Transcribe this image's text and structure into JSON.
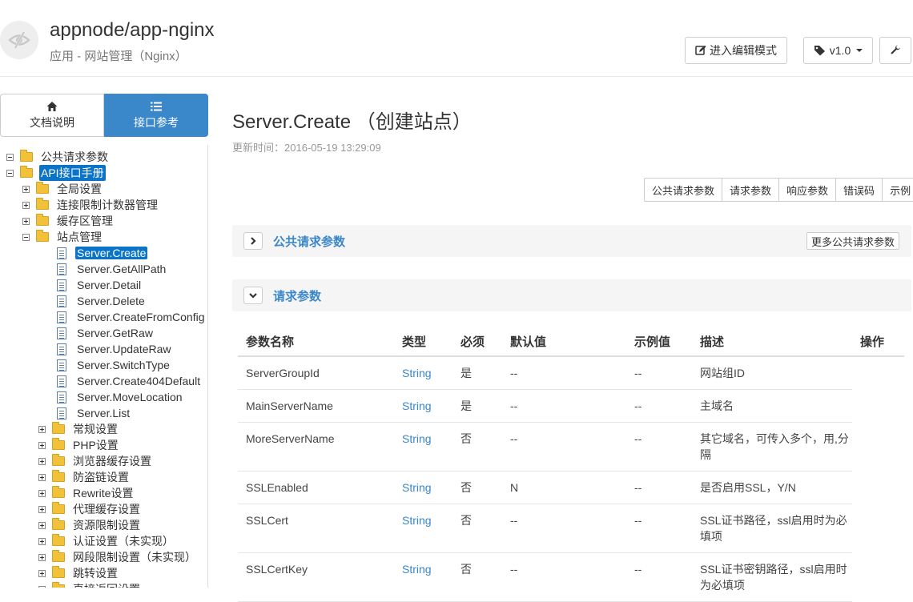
{
  "header": {
    "title": "appnode/app-nginx",
    "subtitle": "应用 - 网站管理（Nginx）",
    "edit_mode_label": "进入编辑模式",
    "version_label": "v1.0"
  },
  "sidebar": {
    "tabs": [
      {
        "label": "文档说明",
        "icon": "home-icon"
      },
      {
        "label": "接口参考",
        "icon": "list-icon"
      }
    ],
    "tree": [
      {
        "label": "公共请求参数",
        "kind": "folder",
        "toggle": "minus",
        "indent": 0
      },
      {
        "label": "API接口手册",
        "kind": "folder",
        "toggle": "minus",
        "indent": 0,
        "selected": true
      },
      {
        "label": "全局设置",
        "kind": "folder",
        "toggle": "plus",
        "indent": 1
      },
      {
        "label": "连接限制计数器管理",
        "kind": "folder",
        "toggle": "plus",
        "indent": 1
      },
      {
        "label": "缓存区管理",
        "kind": "folder",
        "toggle": "plus",
        "indent": 1
      },
      {
        "label": "站点管理",
        "kind": "folder",
        "toggle": "minus",
        "indent": 1
      },
      {
        "label": "Server.Create",
        "kind": "doc",
        "indent": 2,
        "selected": true
      },
      {
        "label": "Server.GetAllPath",
        "kind": "doc",
        "indent": 2
      },
      {
        "label": "Server.Detail",
        "kind": "doc",
        "indent": 2
      },
      {
        "label": "Server.Delete",
        "kind": "doc",
        "indent": 2
      },
      {
        "label": "Server.CreateFromConfig",
        "kind": "doc",
        "indent": 2
      },
      {
        "label": "Server.GetRaw",
        "kind": "doc",
        "indent": 2
      },
      {
        "label": "Server.UpdateRaw",
        "kind": "doc",
        "indent": 2
      },
      {
        "label": "Server.SwitchType",
        "kind": "doc",
        "indent": 2
      },
      {
        "label": "Server.Create404Default",
        "kind": "doc",
        "indent": 2
      },
      {
        "label": "Server.MoveLocation",
        "kind": "doc",
        "indent": 2
      },
      {
        "label": "Server.List",
        "kind": "doc",
        "indent": 2
      },
      {
        "label": "常规设置",
        "kind": "folder",
        "toggle": "plus",
        "indent": 2
      },
      {
        "label": "PHP设置",
        "kind": "folder",
        "toggle": "plus",
        "indent": 2
      },
      {
        "label": "浏览器缓存设置",
        "kind": "folder",
        "toggle": "plus",
        "indent": 2
      },
      {
        "label": "防盗链设置",
        "kind": "folder",
        "toggle": "plus",
        "indent": 2
      },
      {
        "label": "Rewrite设置",
        "kind": "folder",
        "toggle": "plus",
        "indent": 2
      },
      {
        "label": "代理缓存设置",
        "kind": "folder",
        "toggle": "plus",
        "indent": 2
      },
      {
        "label": "资源限制设置",
        "kind": "folder",
        "toggle": "plus",
        "indent": 2
      },
      {
        "label": "认证设置（未实现）",
        "kind": "folder",
        "toggle": "plus",
        "indent": 2
      },
      {
        "label": "网段限制设置（未实现）",
        "kind": "folder",
        "toggle": "plus",
        "indent": 2
      },
      {
        "label": "跳转设置",
        "kind": "folder",
        "toggle": "plus",
        "indent": 2
      },
      {
        "label": "直接返回设置",
        "kind": "folder",
        "toggle": "plus",
        "indent": 2
      }
    ]
  },
  "main": {
    "title": "Server.Create （创建站点）",
    "updated": "更新时间：2016-05-19 13:29:09",
    "section_buttons": [
      "公共请求参数",
      "请求参数",
      "响应参数",
      "错误码",
      "示例"
    ],
    "public_panel": {
      "label": "公共请求参数",
      "more_label": "更多公共请求参数"
    },
    "request_panel": {
      "label": "请求参数"
    },
    "table": {
      "headers": [
        "参数名称",
        "类型",
        "必须",
        "默认值",
        "示例值",
        "描述",
        "操作"
      ],
      "rows": [
        {
          "name": "ServerGroupId",
          "type": "String",
          "required": "是",
          "default": "--",
          "example": "--",
          "desc": "网站组ID"
        },
        {
          "name": "MainServerName",
          "type": "String",
          "required": "是",
          "default": "--",
          "example": "--",
          "desc": "主域名"
        },
        {
          "name": "MoreServerName",
          "type": "String",
          "required": "否",
          "default": "--",
          "example": "--",
          "desc": "其它域名，可传入多个，用,分隔"
        },
        {
          "name": "SSLEnabled",
          "type": "String",
          "required": "否",
          "default": "N",
          "example": "--",
          "desc": "是否启用SSL，Y/N"
        },
        {
          "name": "SSLCert",
          "type": "String",
          "required": "否",
          "default": "--",
          "example": "--",
          "desc": "SSL证书路径，ssl启用时为必填项"
        },
        {
          "name": "SSLCertKey",
          "type": "String",
          "required": "否",
          "default": "--",
          "example": "--",
          "desc": "SSL证书密钥路径，ssl启用时为必填项"
        }
      ]
    }
  }
}
